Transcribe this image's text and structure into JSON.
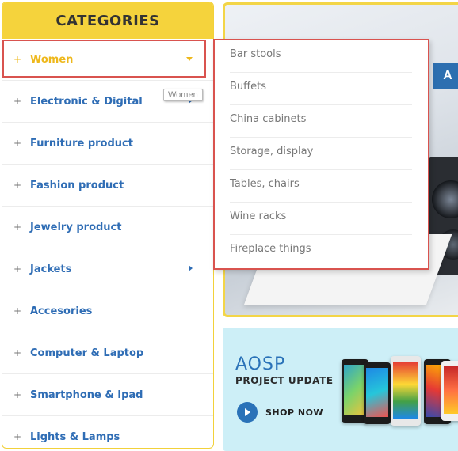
{
  "sidebar": {
    "title": "CATEGORIES",
    "items": [
      {
        "label": "Women",
        "active": true
      },
      {
        "label": "Electronic & Digital"
      },
      {
        "label": "Furniture product"
      },
      {
        "label": "Fashion product"
      },
      {
        "label": "Jewelry product"
      },
      {
        "label": "Jackets"
      },
      {
        "label": "Accesories"
      },
      {
        "label": "Computer & Laptop"
      },
      {
        "label": "Smartphone & Ipad"
      },
      {
        "label": "Lights & Lamps"
      }
    ],
    "plus_glyph": "+",
    "tooltip": "Women"
  },
  "submenu": {
    "items": [
      "Bar stools",
      "Buffets",
      "China cabinets",
      "Storage, display",
      "Tables, chairs",
      "Wine racks",
      "Fireplace things"
    ]
  },
  "banner_top": {
    "tab_text": "A"
  },
  "promo": {
    "title": "AOSP",
    "subtitle": "PROJECT UPDATE",
    "button_label": "SHOP NOW"
  },
  "colors": {
    "accent_yellow": "#f5d33c",
    "link_blue": "#2f6db5",
    "active_yellow": "#eeb81c",
    "highlight_red": "#d9534f",
    "promo_bg": "#cdeff7"
  }
}
